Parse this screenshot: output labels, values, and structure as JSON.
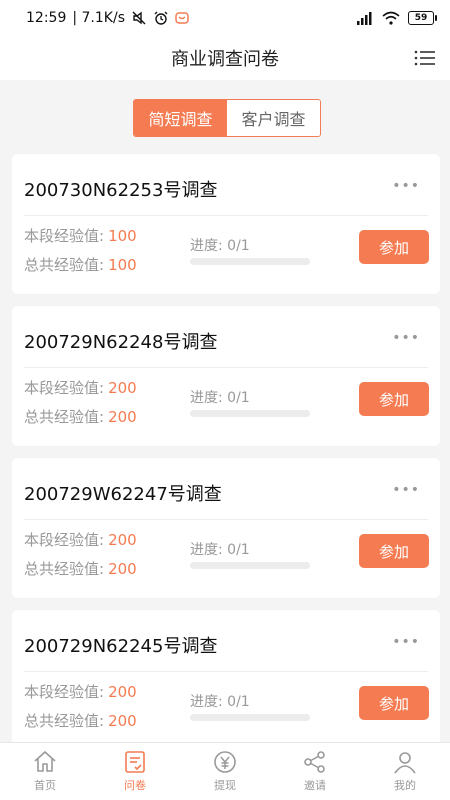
{
  "status_bar": {
    "time": "12:59",
    "speed": "| 7.1K/s",
    "battery": "59"
  },
  "header": {
    "title": "商业调查问卷"
  },
  "tabs": [
    {
      "label": "简短调查",
      "active": true
    },
    {
      "label": "客户调查",
      "active": false
    }
  ],
  "surveys": [
    {
      "title": "200730N62253号调查",
      "segment_label": "本段经验值:",
      "segment_value": "100",
      "total_label": "总共经验值:",
      "total_value": "100",
      "progress_text": "进度: 0/1",
      "progress": 0,
      "action": "参加"
    },
    {
      "title": "200729N62248号调查",
      "segment_label": "本段经验值:",
      "segment_value": "200",
      "total_label": "总共经验值:",
      "total_value": "200",
      "progress_text": "进度: 0/1",
      "progress": 0,
      "action": "参加"
    },
    {
      "title": "200729W62247号调查",
      "segment_label": "本段经验值:",
      "segment_value": "200",
      "total_label": "总共经验值:",
      "total_value": "200",
      "progress_text": "进度: 0/1",
      "progress": 0,
      "action": "参加"
    },
    {
      "title": "200729N62245号调查",
      "segment_label": "本段经验值:",
      "segment_value": "200",
      "total_label": "总共经验值:",
      "total_value": "200",
      "progress_text": "进度: 0/1",
      "progress": 0,
      "action": "参加"
    }
  ],
  "tabbar": [
    {
      "label": "首页",
      "icon": "home-icon",
      "active": false
    },
    {
      "label": "问卷",
      "icon": "survey-icon",
      "active": true
    },
    {
      "label": "提现",
      "icon": "yuan-icon",
      "active": false
    },
    {
      "label": "邀请",
      "icon": "share-icon",
      "active": false
    },
    {
      "label": "我的",
      "icon": "user-icon",
      "active": false
    }
  ],
  "colors": {
    "accent": "#f47b52",
    "muted": "#999999",
    "background": "#f4f4f4"
  }
}
